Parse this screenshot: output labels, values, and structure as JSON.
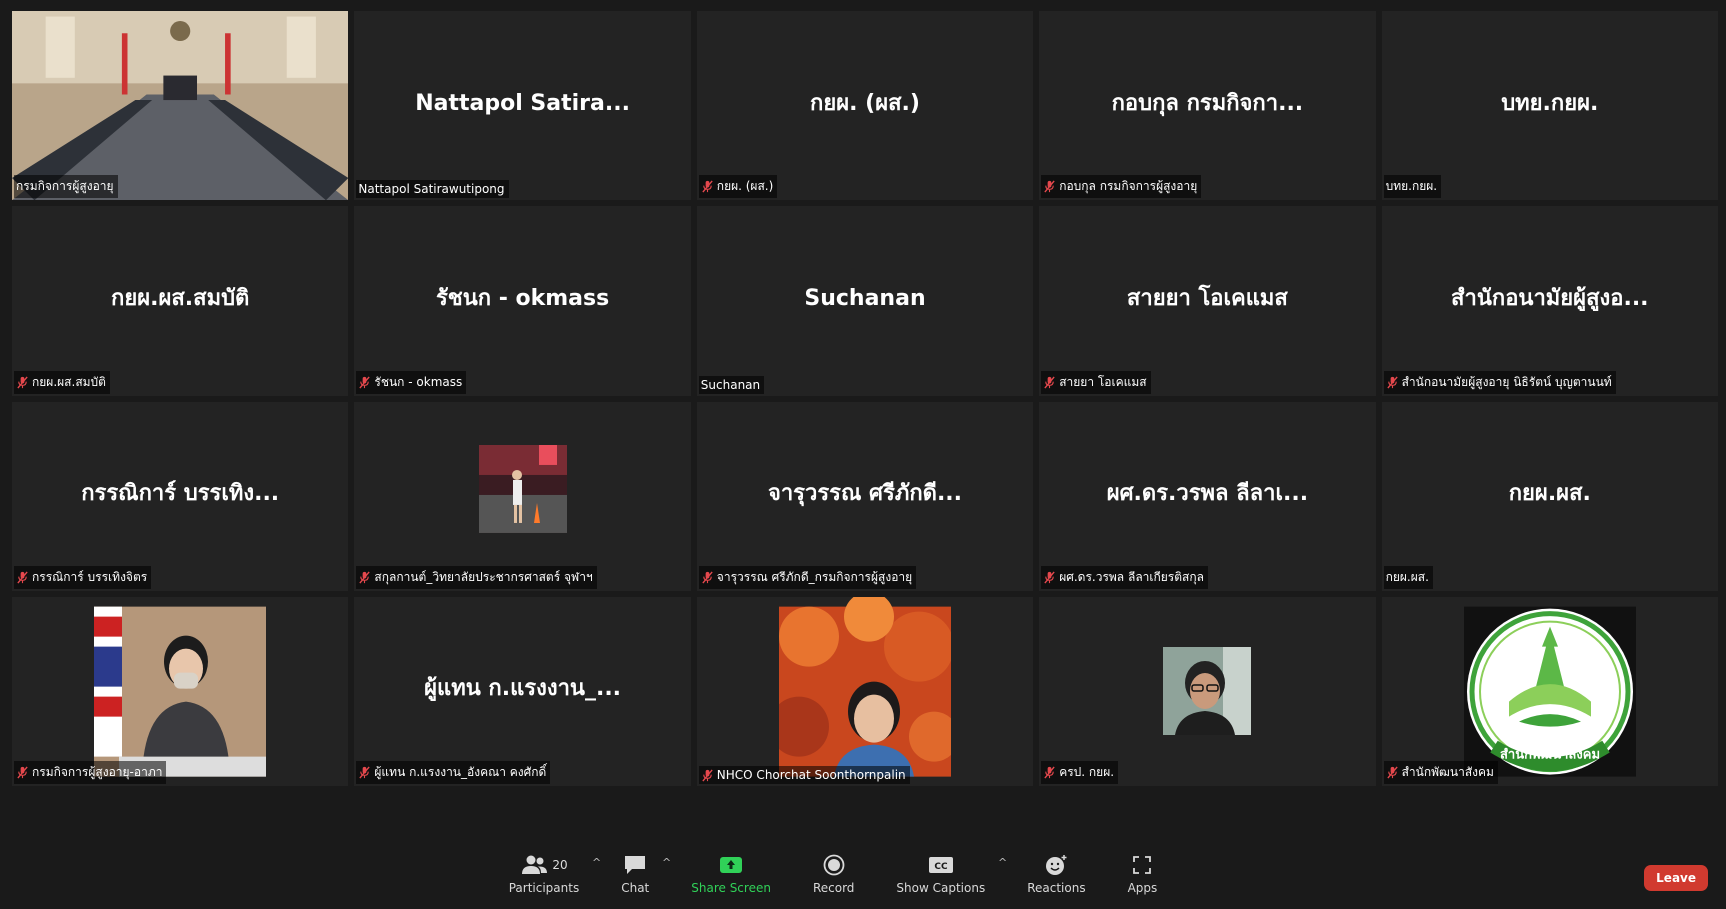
{
  "tiles": [
    {
      "display": "",
      "label": "กรมกิจการผู้สูงอายุ",
      "muted": false,
      "type": "video-room",
      "active": true
    },
    {
      "display": "Nattapol  Satira...",
      "label": "Nattapol Satirawutipong",
      "muted": false,
      "type": "name"
    },
    {
      "display": "กยผ. (ผส.)",
      "label": "กยผ. (ผส.)",
      "muted": true,
      "type": "name"
    },
    {
      "display": "กอบกุล กรมกิจกา...",
      "label": "กอบกุล กรมกิจการผู้สูงอายุ",
      "muted": true,
      "type": "name"
    },
    {
      "display": "บทย.กยผ.",
      "label": "บทย.กยผ.",
      "muted": false,
      "type": "name"
    },
    {
      "display": "กยผ.ผส.สมบัติ",
      "label": "กยผ.ผส.สมบัติ",
      "muted": true,
      "type": "name"
    },
    {
      "display": "รัชนก - okmass",
      "label": "รัชนก - okmass",
      "muted": true,
      "type": "name"
    },
    {
      "display": "Suchanan",
      "label": "Suchanan",
      "muted": false,
      "type": "name"
    },
    {
      "display": "สายยา โอเคแมส",
      "label": "สายยา โอเคแมส",
      "muted": true,
      "type": "name"
    },
    {
      "display": "สำนักอนามัยผู้สูงอ...",
      "label": "สำนักอนามัยผู้สูงอายุ นิธิรัตน์ บุญตานนท์",
      "muted": true,
      "type": "name"
    },
    {
      "display": "กรรณิการ์ บรรเทิง...",
      "label": "กรรณิการ์ บรรเทิงจิตร",
      "muted": true,
      "type": "name"
    },
    {
      "display": "",
      "label": "สกุลกานต์_วิทยาลัยประชากรศาสตร์ จุฬาฯ",
      "muted": true,
      "type": "photo-street"
    },
    {
      "display": "จารุวรรณ ศรีภักดี...",
      "label": "จารุวรรณ ศรีภักดี_กรมกิจการผู้สูงอายุ",
      "muted": true,
      "type": "name"
    },
    {
      "display": "ผศ.ดร.วรพล ลีลาเ...",
      "label": "ผศ.ดร.วรพล ลีลาเกียรติสกุล",
      "muted": true,
      "type": "name"
    },
    {
      "display": "กยผ.ผส.",
      "label": "กยผ.ผส.",
      "muted": false,
      "type": "name"
    },
    {
      "display": "",
      "label": "กรมกิจการผู้สูงอายุ-อาภา",
      "muted": true,
      "type": "video-woman"
    },
    {
      "display": "ผู้แทน ก.แรงงาน_...",
      "label": "ผู้แทน ก.แรงงาน_อังคณา คงศักดิ์",
      "muted": true,
      "type": "name"
    },
    {
      "display": "",
      "label": "NHCO Chorchat Soonthornpalin",
      "muted": true,
      "type": "photo-autumn"
    },
    {
      "display": "",
      "label": "ครป. กยผ.",
      "muted": true,
      "type": "photo-man"
    },
    {
      "display": "",
      "label": "สำนักพัฒนาสังคม",
      "muted": true,
      "type": "logo"
    }
  ],
  "logo_text": "สำนักพัฒนาสังคม",
  "toolbar": {
    "participants_label": "Participants",
    "participants_count": "20",
    "chat_label": "Chat",
    "share_label": "Share Screen",
    "record_label": "Record",
    "captions_label": "Show Captions",
    "cc_text": "CC",
    "reactions_label": "Reactions",
    "apps_label": "Apps",
    "leave_label": "Leave"
  },
  "colors": {
    "active_border": "#c5e85f",
    "tile_bg": "#232323",
    "mute_red": "#e5484d",
    "share_green": "#30d158",
    "leave_red": "#d13a2f"
  }
}
